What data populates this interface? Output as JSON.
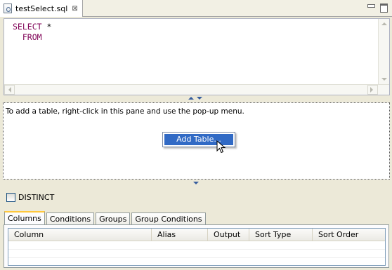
{
  "editor": {
    "tab_title": "testSelect.sql",
    "close_glyph": "⊠"
  },
  "sql": {
    "line1_keyword": "SELECT",
    "line1_rest": " *",
    "line2_keyword": "FROM"
  },
  "diagram": {
    "hint": "To add a table, right-click in this pane and use the pop-up menu.",
    "menu_item": "Add Table..."
  },
  "options": {
    "distinct_label": "DISTINCT"
  },
  "tabs": [
    {
      "label": "Columns"
    },
    {
      "label": "Conditions"
    },
    {
      "label": "Groups"
    },
    {
      "label": "Group Conditions"
    }
  ],
  "table": {
    "columns": [
      "Column",
      "Alias",
      "Output",
      "Sort Type",
      "Sort Order"
    ]
  },
  "colors": {
    "keyword": "#7f0055",
    "selection": "#316ac5",
    "active_tab_accent": "#ffc83c"
  }
}
